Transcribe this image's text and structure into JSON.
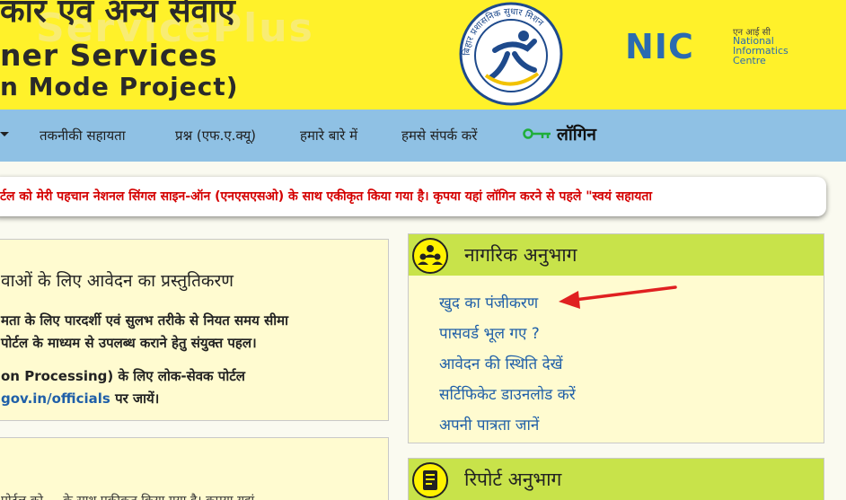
{
  "header": {
    "hindi_title": "कार एवं अन्य सेवाएँ",
    "english_line1": "ner Services",
    "english_line2": "n Mode Project)",
    "watermark": "ServicePlus",
    "emblem_text": "बिहार प्रशासनिक सुधार मिशन",
    "nic_logo": "NIC",
    "nic_hindi": "एन आई सी",
    "nic_english": "National Informatics Centre"
  },
  "nav": {
    "items": [
      {
        "label": "तकनीकी सहायता"
      },
      {
        "label": "प्रश्न (एफ.ए.क्यू)"
      },
      {
        "label": "हमारे बारे में"
      },
      {
        "label": "हमसे संपर्क करें"
      }
    ],
    "login_label": "लॉगिन"
  },
  "marquee": {
    "text": "र्टल को मेरी पहचान नेशनल सिंगल साइन-ऑन (एनएसएसओ) के साथ एकीकृत किया गया है। कृपया यहां लॉगिन करने से पहले \"स्वयं सहायता"
  },
  "left_box": {
    "title": "वाओं के लिए आवेदन का प्रस्तुतिकरण",
    "para1_line1": "मता के लिए पारदर्शी एवं सुलभ तरीके से नियत समय सीमा",
    "para1_line2": "पोर्टल के माध्यम से उपलब्ध कराने हेतु संयुक्त पहल।",
    "para2_line1": "on Processing) के लिए लोक-सेवक पोर्टल",
    "para2_link": "gov.in/officials",
    "para2_suffix": " पर जायें।"
  },
  "left_box2": {
    "text": "पोर्टल को ... के साथ एकीकृत किया गया है। कृपया यहां"
  },
  "citizen_panel": {
    "title": "नागरिक अनुभाग",
    "icon": "people-group-icon",
    "links": [
      {
        "label": "खुद का पंजीकरण"
      },
      {
        "label": "पासवर्ड भूल गए ?"
      },
      {
        "label": "आवेदन की स्थिति देखें"
      },
      {
        "label": "सर्टिफिकेट डाउनलोड करें"
      },
      {
        "label": "अपनी पात्रता जानें"
      }
    ]
  },
  "report_panel": {
    "title": "रिपोर्ट अनुभाग",
    "icon": "report-document-icon"
  },
  "colors": {
    "header_bg": "#fff12a",
    "nav_bg": "#8fc1e4",
    "marquee_text": "#d40000",
    "panel_header": "#c8e34a",
    "panel_bg": "#fffbd0",
    "link": "#1f5fa8",
    "nic_blue": "#2b6bb0",
    "arrow": "#e02020"
  }
}
